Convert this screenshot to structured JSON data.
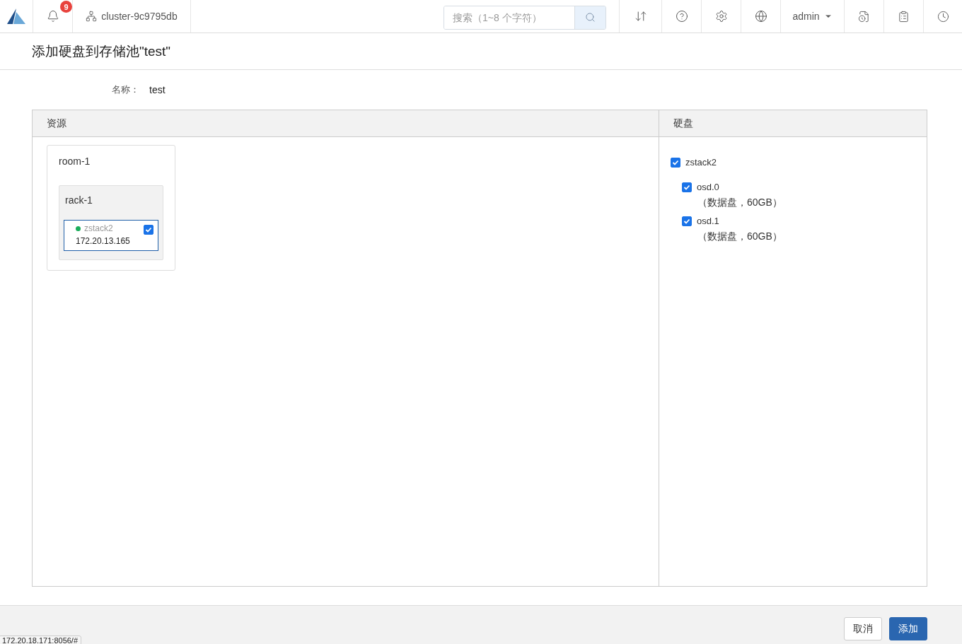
{
  "topbar": {
    "notification_count": "9",
    "cluster": "cluster-9c9795db",
    "search": {
      "placeholder": "搜索（1~8 个字符）"
    },
    "user": "admin"
  },
  "page_title": "添加硬盘到存储池\"test\"",
  "name_field": {
    "label": "名称：",
    "value": "test"
  },
  "resources": {
    "header": "资源",
    "rooms": [
      {
        "name": "room-1",
        "racks": [
          {
            "name": "rack-1",
            "hosts": [
              {
                "name": "zstack2",
                "ip": "172.20.13.165",
                "color": "#1aad5a",
                "checked": true
              }
            ]
          }
        ]
      }
    ]
  },
  "disks": {
    "header": "硬盘",
    "hosts": [
      {
        "name": "zstack2",
        "checked": true,
        "disks": [
          {
            "name": "osd.0",
            "detail": "（数据盘，60GB）",
            "checked": true
          },
          {
            "name": "osd.1",
            "detail": "（数据盘，60GB）",
            "checked": true
          }
        ]
      }
    ]
  },
  "buttons": {
    "cancel": "取消",
    "add": "添加"
  },
  "status_url": "172.20.18.171:8056/#"
}
